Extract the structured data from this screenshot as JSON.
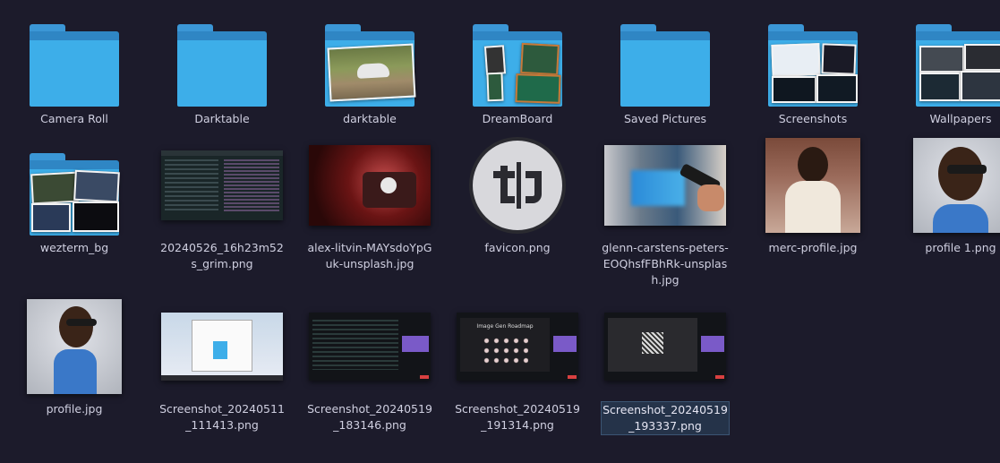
{
  "items": [
    {
      "label": "Camera Roll"
    },
    {
      "label": "Darktable"
    },
    {
      "label": "darktable"
    },
    {
      "label": "DreamBoard"
    },
    {
      "label": "Saved Pictures"
    },
    {
      "label": "Screenshots"
    },
    {
      "label": "Wallpapers"
    },
    {
      "label": "wezterm_bg"
    },
    {
      "label": "20240526_16h23m52s_grim.png"
    },
    {
      "label": "alex-litvin-MAYsdoYpGuk-unsplash.jpg"
    },
    {
      "label": "favicon.png"
    },
    {
      "label": "glenn-carstens-peters-EOQhsfFBhRk-unsplash.jpg"
    },
    {
      "label": "merc-profile.jpg"
    },
    {
      "label": "profile 1.png"
    },
    {
      "label": "profile.jpg"
    },
    {
      "label": "Screenshot_20240511_111413.png"
    },
    {
      "label": "Screenshot_20240519_183146.png"
    },
    {
      "label": "Screenshot_20240519_191314.png"
    },
    {
      "label": "Screenshot_20240519_193337.png"
    }
  ],
  "thumb_text": {
    "image_gen_roadmap": "Image Gen Roadmap"
  },
  "colors": {
    "background": "#1c1b2b",
    "folder": "#3daee9",
    "selection": "#253349"
  }
}
